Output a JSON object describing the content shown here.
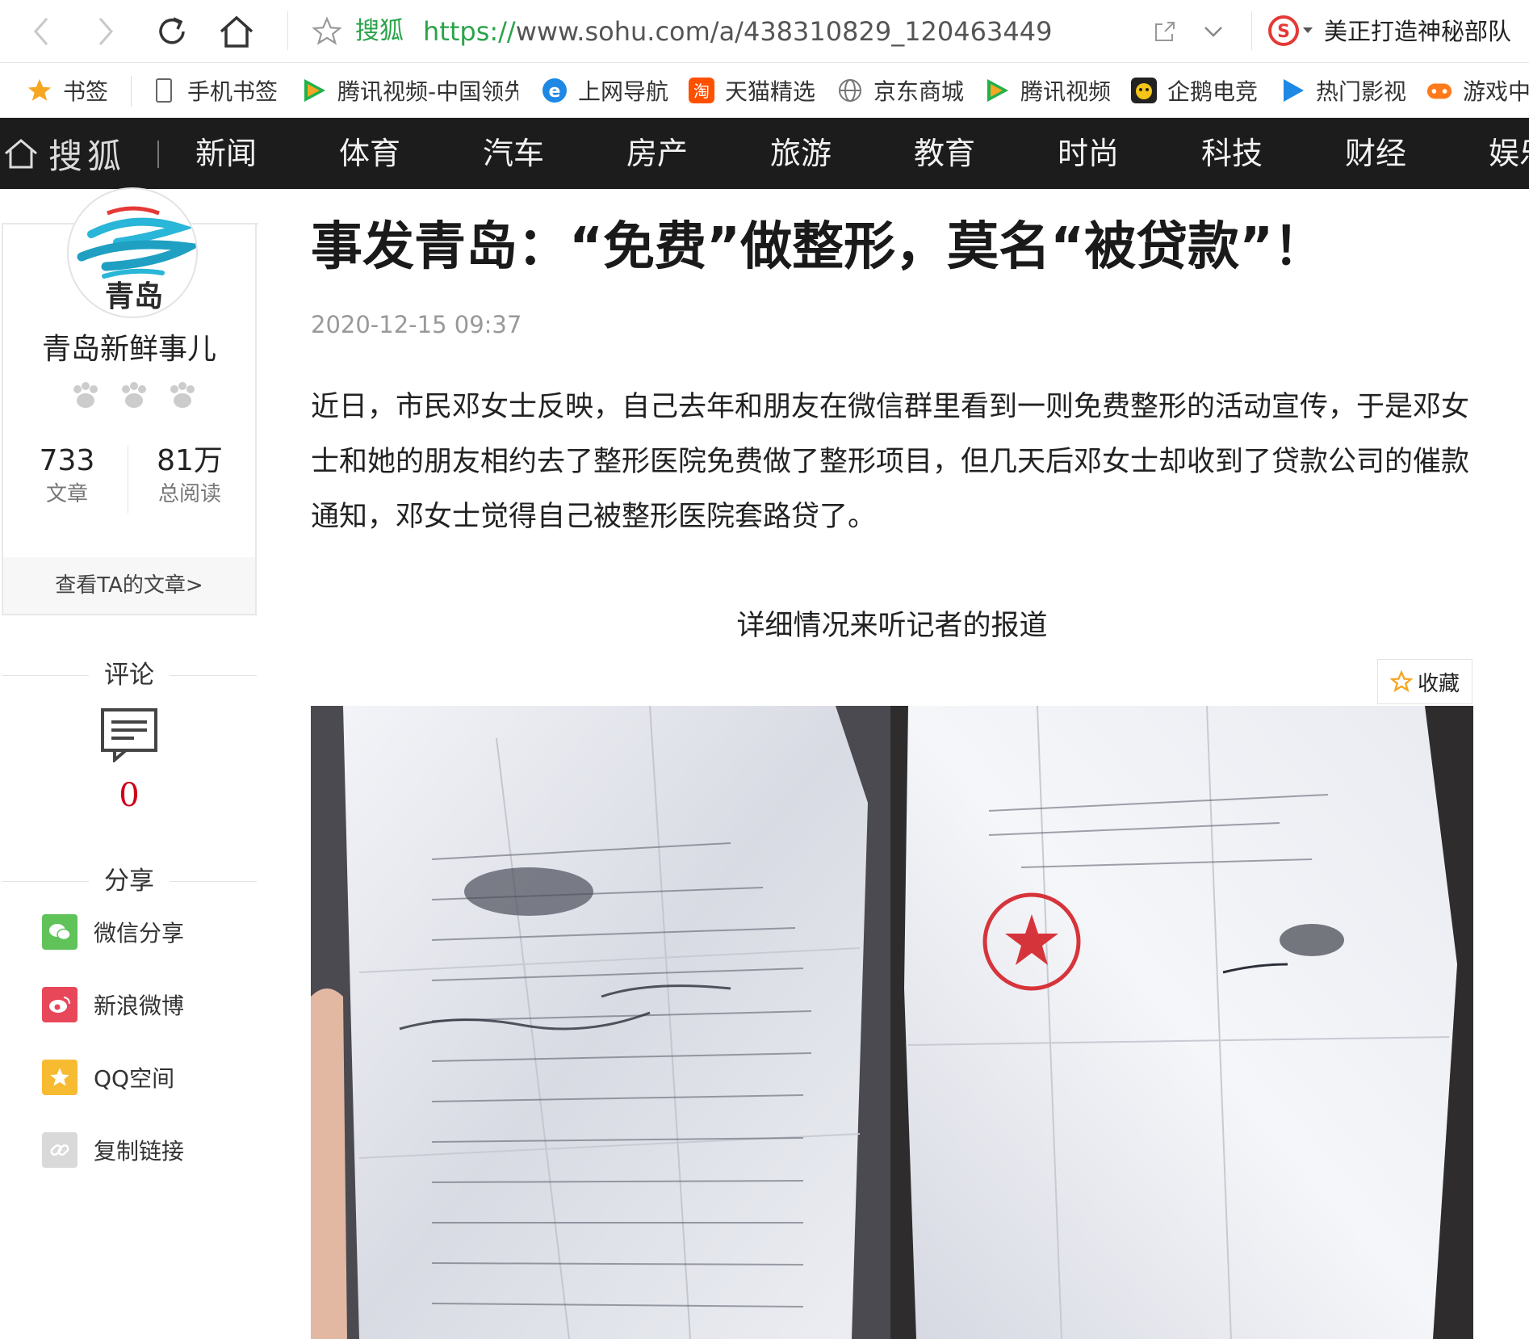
{
  "browser": {
    "site_name": "搜狐",
    "url_proto": "https://",
    "url_rest": "www.sohu.com/a/438310829_120463449",
    "search_hint": "美正打造神秘部队"
  },
  "bookmarks": [
    {
      "label": "书签",
      "icon": "star-icon"
    },
    {
      "label": "手机书签",
      "icon": "phone-icon"
    },
    {
      "label": "腾讯视频-中国领先",
      "icon": "tencent-video-icon"
    },
    {
      "label": "上网导航",
      "icon": "ie-icon"
    },
    {
      "label": "天猫精选",
      "icon": "tmall-icon"
    },
    {
      "label": "京东商城",
      "icon": "globe-icon"
    },
    {
      "label": "腾讯视频",
      "icon": "tencent-video-icon"
    },
    {
      "label": "企鹅电竞",
      "icon": "penguin-icon"
    },
    {
      "label": "热门影视",
      "icon": "play-icon"
    },
    {
      "label": "游戏中心",
      "icon": "gamepad-icon"
    }
  ],
  "channel_nav": {
    "brand": "搜狐",
    "items": [
      "新闻",
      "体育",
      "汽车",
      "房产",
      "旅游",
      "教育",
      "时尚",
      "科技",
      "财经",
      "娱乐"
    ]
  },
  "author": {
    "avatar_text": "青岛",
    "name": "青岛新鲜事儿",
    "articles_count": "733",
    "articles_label": "文章",
    "reads_count": "81万",
    "reads_label": "总阅读",
    "view_link": "查看TA的文章>"
  },
  "comments": {
    "title": "评论",
    "count": "0"
  },
  "share": {
    "title": "分享",
    "items": [
      {
        "label": "微信分享",
        "icon": "wechat-icon",
        "color": "#5fc35a"
      },
      {
        "label": "新浪微博",
        "icon": "weibo-icon",
        "color": "#e8475a"
      },
      {
        "label": "QQ空间",
        "icon": "qzone-icon",
        "color": "#f7bb32"
      },
      {
        "label": "复制链接",
        "icon": "link-icon",
        "color": "#d9d9d9"
      }
    ]
  },
  "article": {
    "title": "事发青岛：“免费”做整形，莫名“被贷款”！",
    "timestamp": "2020-12-15 09:37",
    "paragraph": "近日，市民邓女士反映，自己去年和朋友在微信群里看到一则免费整形的活动宣传，于是邓女士和她的朋友相约去了整形医院免费做了整形项目，但几天后邓女士却收到了贷款公司的催款通知，邓女士觉得自己被整形医院套路贷了。",
    "caption": "详细情况来听记者的报道",
    "favorite_label": "收藏"
  },
  "colors": {
    "channel_bg": "#1c1c1c",
    "url_green": "#2aa34a",
    "comment_red": "#d0021b"
  }
}
